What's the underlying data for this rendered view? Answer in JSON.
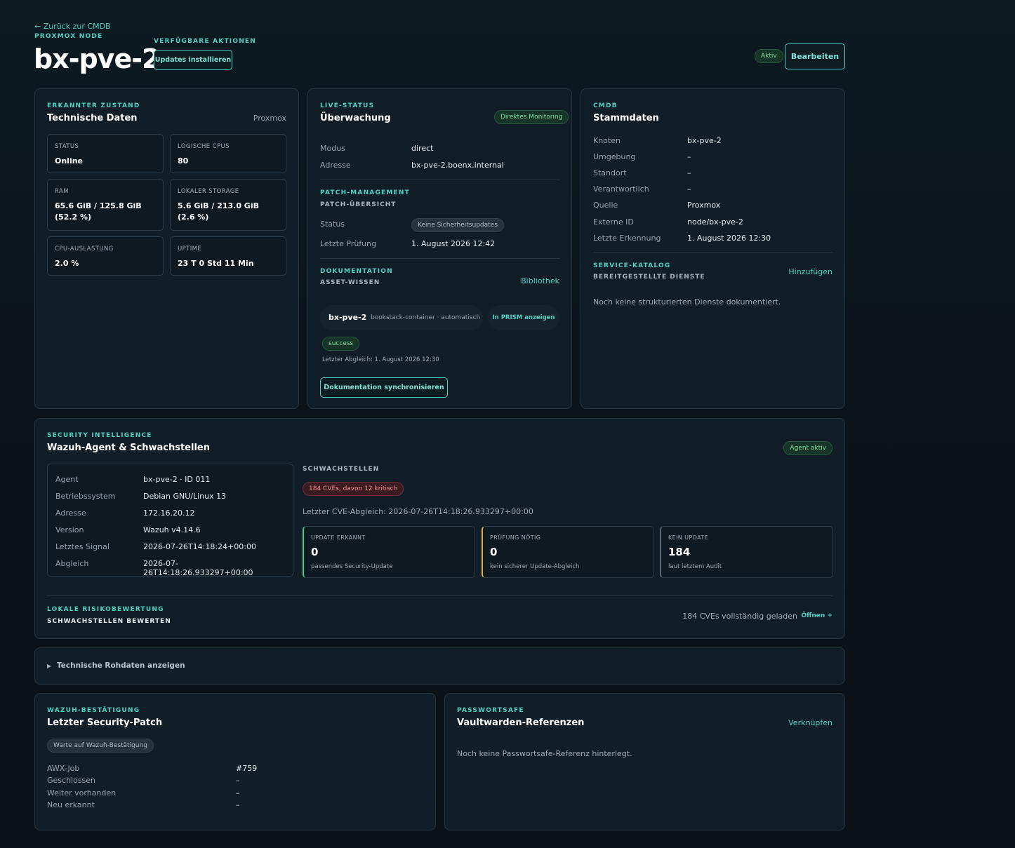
{
  "header": {
    "back_link": "← Zurück zur CMDB",
    "kind": "PROXMOX NODE",
    "title": "bx-pve-2",
    "actions_label": "VERFÜGBARE AKTIONEN",
    "updates_button": "Updates installieren",
    "status_badge": "Aktiv",
    "edit_button": "Bearbeiten"
  },
  "tech": {
    "kicker": "ERKANNTER ZUSTAND",
    "title": "Technische Daten",
    "source": "Proxmox",
    "tiles": [
      {
        "label": "STATUS",
        "value": "Online"
      },
      {
        "label": "LOGISCHE CPUS",
        "value": "80"
      },
      {
        "label": "RAM",
        "value": "65.6 GiB / 125.8 GiB (52.2 %)"
      },
      {
        "label": "LOKALER STORAGE",
        "value": "5.6 GiB / 213.0 GiB (2.6 %)"
      },
      {
        "label": "CPU-AUSLASTUNG",
        "value": "2.0 %"
      },
      {
        "label": "UPTIME",
        "value": "23 T 0 Std 11 Min"
      }
    ]
  },
  "live": {
    "kicker": "LIVE-STATUS",
    "title": "Überwachung",
    "monitor_badge": "Direktes Monitoring",
    "rows": [
      {
        "key": "Modus",
        "value": "direct"
      },
      {
        "key": "Adresse",
        "value": "bx-pve-2.boenx.internal"
      }
    ],
    "patch": {
      "kicker": "PATCH-MANAGEMENT",
      "sub": "PATCH-ÜBERSICHT",
      "status_key": "Status",
      "status_badge": "Keine Sicherheitsupdates",
      "last_key": "Letzte Prüfung",
      "last_value": "1. August 2026 12:42"
    },
    "docs": {
      "kicker": "DOKUMENTATION",
      "sub": "ASSET-WISSEN",
      "library_link": "Bibliothek",
      "item_name": "bx-pve-2",
      "item_meta": "bookstack-container · automatisch",
      "prism_link": "In PRISM anzeigen",
      "result_badge": "success",
      "last_sync": "Letzter Abgleich: 1. August 2026 12:30",
      "sync_button": "Dokumentation synchronisieren"
    }
  },
  "cmdb": {
    "kicker": "CMDB",
    "title": "Stammdaten",
    "rows": [
      {
        "key": "Knoten",
        "value": "bx-pve-2"
      },
      {
        "key": "Umgebung",
        "value": "–"
      },
      {
        "key": "Standort",
        "value": "–"
      },
      {
        "key": "Verantwortlich",
        "value": "–"
      },
      {
        "key": "Quelle",
        "value": "Proxmox"
      },
      {
        "key": "Externe ID",
        "value": "node/bx-pve-2"
      },
      {
        "key": "Letzte Erkennung",
        "value": "1. August 2026 12:30"
      }
    ],
    "service": {
      "kicker": "SERVICE-KATALOG",
      "sub": "BEREITGESTELLTE DIENSTE",
      "add_link": "Hinzufügen",
      "empty": "Noch keine strukturierten Dienste dokumentiert."
    }
  },
  "security": {
    "kicker": "SECURITY INTELLIGENCE",
    "title": "Wazuh-Agent & Schwachstellen",
    "agent_badge": "Agent aktiv",
    "agent_rows": [
      {
        "key": "Agent",
        "value": "bx-pve-2 · ID 011"
      },
      {
        "key": "Betriebssystem",
        "value": "Debian GNU/Linux 13"
      },
      {
        "key": "Adresse",
        "value": "172.16.20.12"
      },
      {
        "key": "Version",
        "value": "Wazuh v4.14.6"
      },
      {
        "key": "Letztes Signal",
        "value": "2026-07-26T14:18:24+00:00"
      },
      {
        "key": "Abgleich",
        "value": "2026-07-26T14:18:26.933297+00:00"
      }
    ],
    "vuln_title": "SCHWACHSTELLEN",
    "cve_badge": "184 CVEs, davon 12 kritisch",
    "last_cve": "Letzter CVE-Abgleich: 2026-07-26T14:18:26.933297+00:00",
    "stats": [
      {
        "label": "UPDATE ERKANNT",
        "value": "0",
        "sub": "passendes Security-Update",
        "color": "#3fcf8e"
      },
      {
        "label": "PRÜFUNG NÖTIG",
        "value": "0",
        "sub": "kein sicherer Update-Abgleich",
        "color": "#e3b04b"
      },
      {
        "label": "KEIN UPDATE",
        "value": "184",
        "sub": "laut letztem Audit",
        "color": "#5b6873"
      }
    ],
    "risk_kicker": "LOKALE RISIKOBEWERTUNG",
    "risk_sub": "SCHWACHSTELLEN BEWERTEN",
    "risk_loaded": "184 CVEs vollständig geladen",
    "risk_open": "Öffnen +"
  },
  "raw": {
    "label": "Technische Rohdaten anzeigen"
  },
  "patch_confirm": {
    "kicker": "WAZUH-BESTÄTIGUNG",
    "title": "Letzter Security-Patch",
    "wait_badge": "Warte auf Wazuh-Bestätigung",
    "rows": [
      {
        "key": "AWX-Job",
        "value": "#759"
      },
      {
        "key": "Geschlossen",
        "value": "–"
      },
      {
        "key": "Weiter vorhanden",
        "value": "–"
      },
      {
        "key": "Neu erkannt",
        "value": "–"
      }
    ]
  },
  "vault": {
    "kicker": "PASSWORTSAFE",
    "title": "Vaultwarden-Referenzen",
    "link": "Verknüpfen",
    "empty": "Noch keine Passwortsafe-Referenz hinterlegt."
  }
}
